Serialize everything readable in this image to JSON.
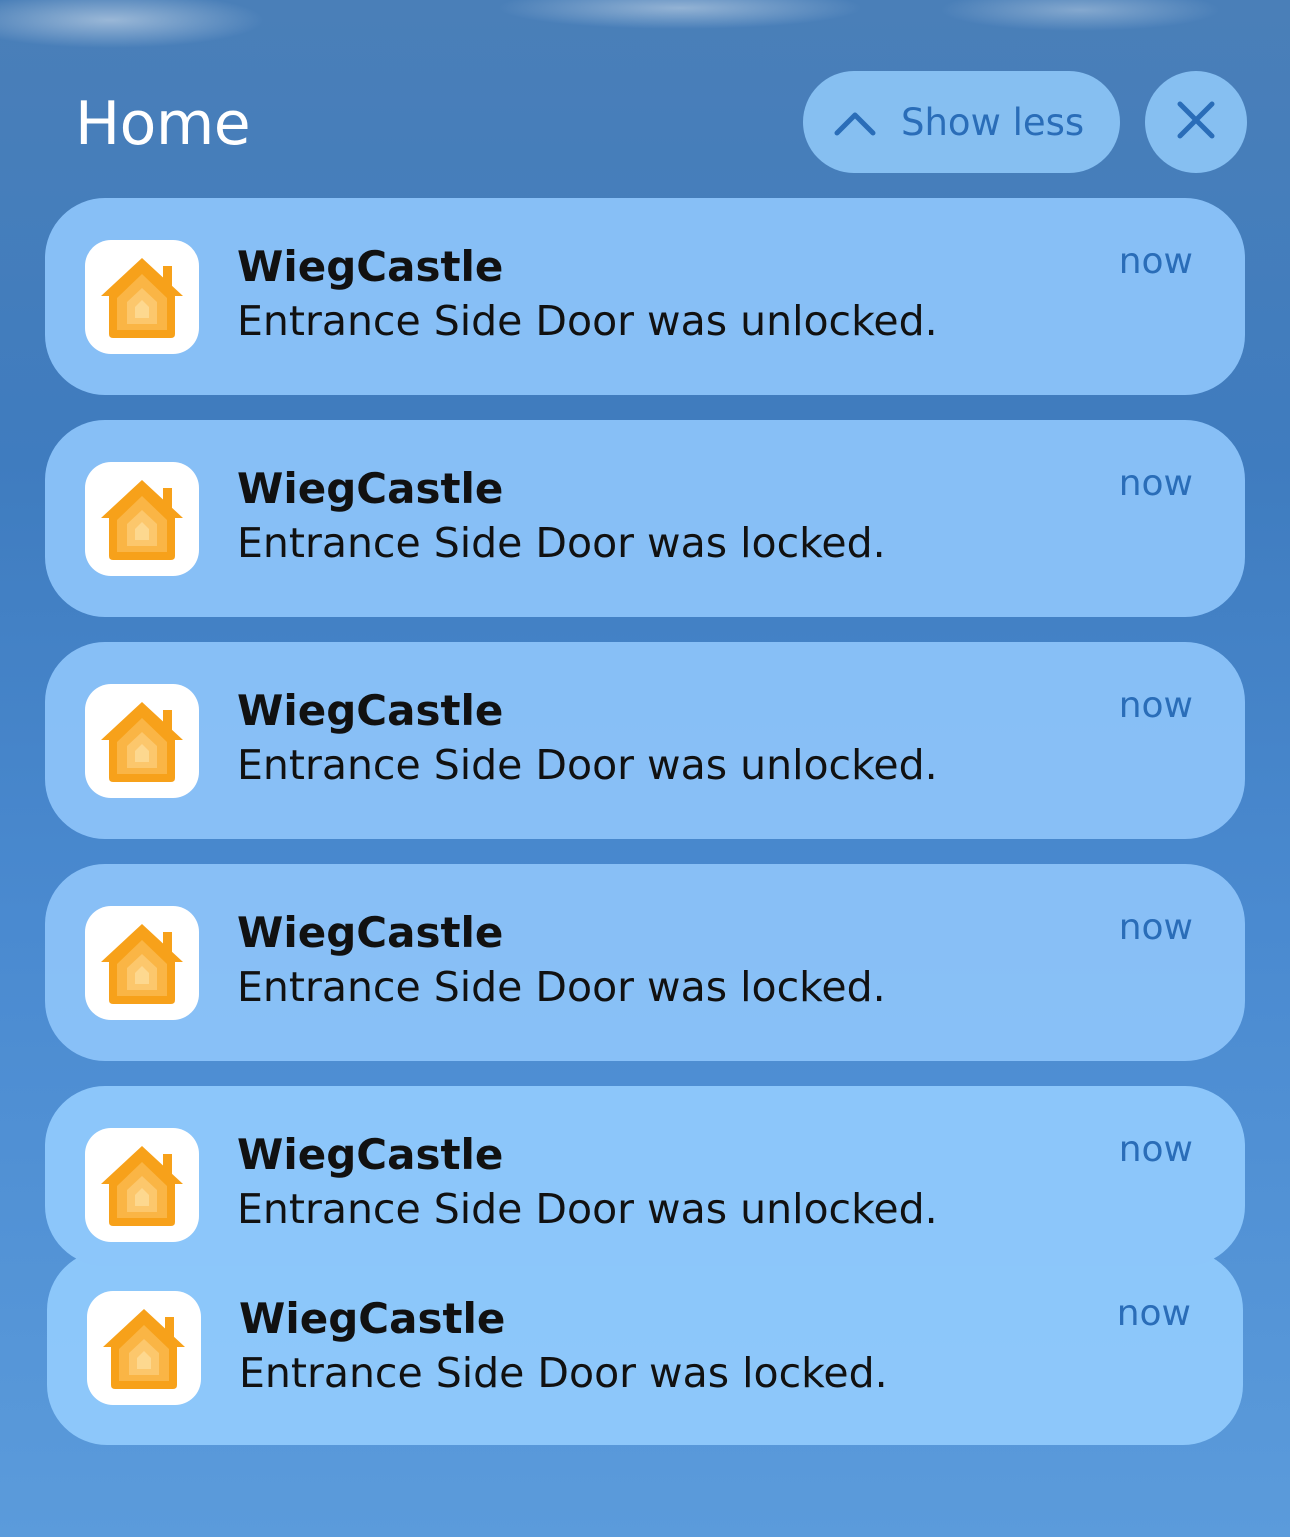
{
  "header": {
    "title": "Home",
    "show_less_label": "Show less"
  },
  "notifications": [
    {
      "title": "WiegCastle",
      "body": "Entrance Side Door was unlocked.",
      "time": "now"
    },
    {
      "title": "WiegCastle",
      "body": "Entrance Side Door was locked.",
      "time": "now"
    },
    {
      "title": "WiegCastle",
      "body": "Entrance Side Door was unlocked.",
      "time": "now"
    },
    {
      "title": "WiegCastle",
      "body": "Entrance Side Door was locked.",
      "time": "now"
    },
    {
      "title": "WiegCastle",
      "body": "Entrance Side Door was unlocked.",
      "time": "now"
    },
    {
      "title": "WiegCastle",
      "body": "Entrance Side Door was locked.",
      "time": "now"
    }
  ],
  "icons": {
    "app": "home-app-icon",
    "show_less": "chevron-up-icon",
    "close": "close-icon"
  },
  "colors": {
    "accent": "#2a6db8",
    "card": "#8ac2f8",
    "icon_orange": "#f7a11a"
  }
}
